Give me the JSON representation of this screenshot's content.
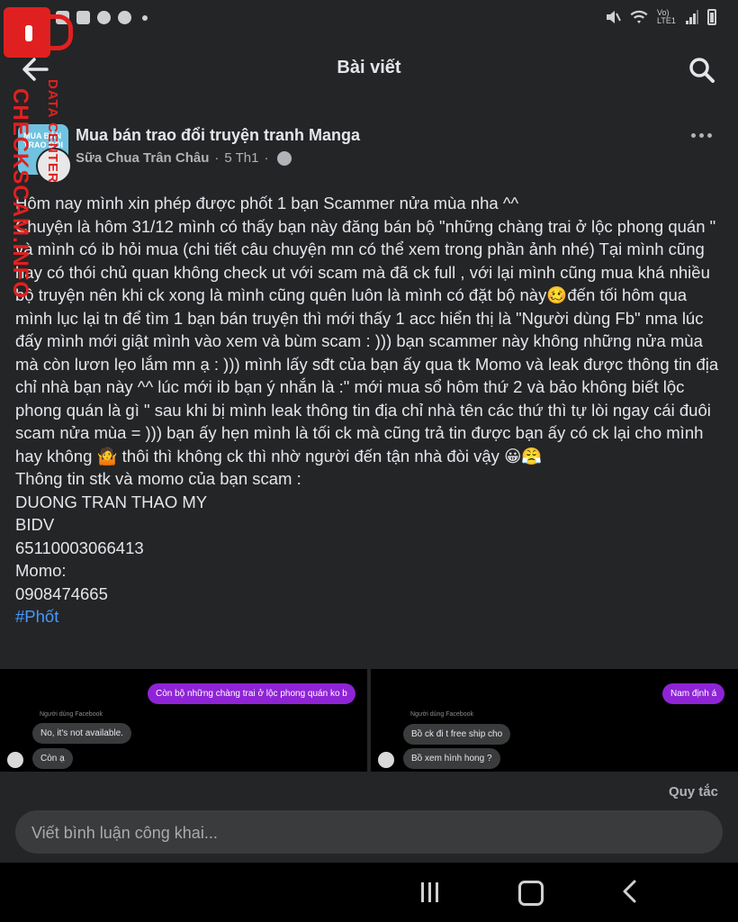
{
  "status_bar": {
    "network_label": "Vo) LTE1"
  },
  "header": {
    "title": "Bài viết"
  },
  "watermark": {
    "big_text": "CHECKSCAM.INFO",
    "small_text": "DATA CENTER"
  },
  "post": {
    "group_name": "Mua bán trao đổi truyện tranh Manga",
    "group_avatar_text": "MUA BÁN TRAO ĐỔI",
    "author": "Sữa Chua Trân Châu",
    "date": "5 Th1",
    "paragraphs": [
      "Hôm nay mình xin phép được phốt 1 bạn Scammer nửa mùa nha ^^",
      "Chuyện là hôm 31/12 mình có thấy bạn này đăng bán bộ \"những chàng trai ở lộc phong quán \" và mình có ib hỏi mua (chi tiết câu chuyện mn có thể xem trong phần ảnh nhé) Tại mình cũng hay có thói chủ quan không check ut với scam mà đã ck full , với lại mình cũng mua khá nhiều bộ truyện nên khi ck xong là mình cũng quên luôn là mình có đặt bộ này🥴đến tối hôm qua mình lục lại tn để tìm 1 bạn bán truyện thì mới thấy 1 acc hiển thị là \"Người dùng Fb\" nma lúc đấy mình mới giật mình vào xem và bùm scam : ))) bạn scammer này không những nửa mùa mà còn lươn lẹo lắm mn ạ : ))) mình lấy sđt của bạn ấy qua tk Momo và leak được thông tin địa chỉ nhà bạn này ^^ lúc mới ib bạn ý nhắn là :\" mới mua sổ hôm thứ 2 và bảo không biết lộc phong quán là gì \" sau khi bị mình leak thông tin địa chỉ nhà tên các thứ thì tự lòi ngay cái đuôi scam nửa mùa = ))) bạn ấy hẹn mình là tối ck mà cũng trả tin được bạn ấy có ck lại cho mình hay không 🤷 thôi thì không ck thì nhờ người đến tận nhà đòi vậy 😀😤",
      "Thông tin stk và momo của bạn scam :",
      "DUONG TRAN THAO MY",
      "BIDV",
      "65110003066413",
      "Momo:",
      "0908474665"
    ],
    "hashtag": "#Phốt"
  },
  "images": {
    "left": {
      "out_message": "Còn bộ những chàng trai ở lộc phong quán ko b",
      "sender_label": "Người dùng Facebook",
      "in_messages": [
        "No, it's not available.",
        "Còn ạ"
      ]
    },
    "right": {
      "out_message": "Nam định á",
      "sender_label": "Người dùng Facebook",
      "in_messages": [
        "Bồ ck đi t free ship cho",
        "Bồ xem hình hong ?"
      ]
    }
  },
  "footer": {
    "rules_label": "Quy tắc",
    "comment_placeholder": "Viết bình luận công khai..."
  }
}
